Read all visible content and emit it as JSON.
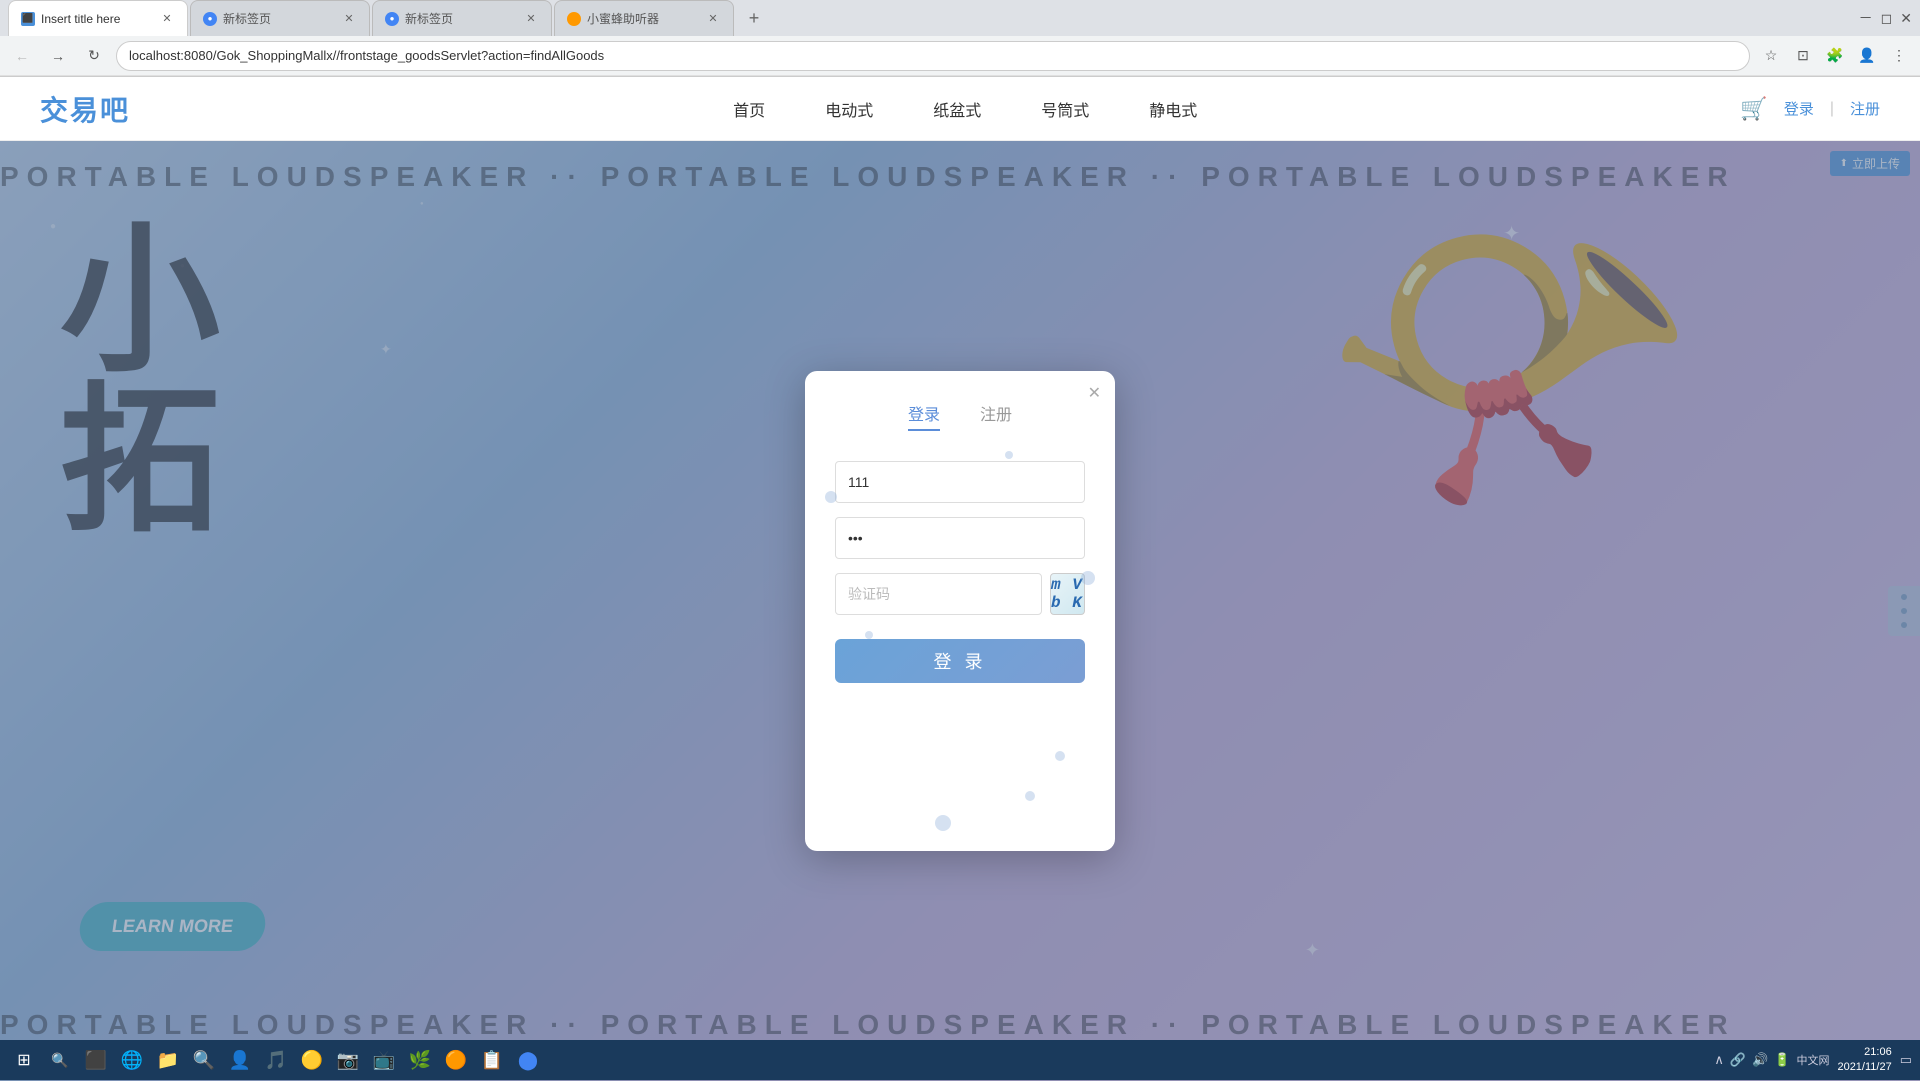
{
  "browser": {
    "tabs": [
      {
        "id": "tab1",
        "title": "Insert title here",
        "favicon": "page",
        "active": true
      },
      {
        "id": "tab2",
        "title": "新标签页",
        "favicon": "chrome",
        "active": false
      },
      {
        "id": "tab3",
        "title": "新标签页",
        "favicon": "chrome",
        "active": false
      },
      {
        "id": "tab4",
        "title": "小蜜蜂助听器",
        "favicon": "bee",
        "active": false
      }
    ],
    "url": "localhost:8080/Gok_ShoppingMallx//frontstage_goodsServlet?action=findAllGoods",
    "new_tab_label": "+"
  },
  "site": {
    "logo": "交易吧",
    "nav": [
      "首页",
      "电动式",
      "纸盆式",
      "号筒式",
      "静电式"
    ],
    "login": "登录",
    "register": "注册",
    "divider": "|"
  },
  "banner": {
    "marquee_top": "PORTABLE LOUDSPEAKER  ··  PORTABLE LOUDSPEAKER  ··  PORTABLE LOUDSPEAKER",
    "marquee_bottom": "PORTABLE LOUDSPEAKER  ··  PORTABLE LOUDSPEAKER  ··  PORTABLE LOUDSPEAKER",
    "big_text_line1": "小",
    "big_text_line2": "拓",
    "learn_more": "LEARN MORE",
    "promo_badge": "立即上传"
  },
  "modal": {
    "close_label": "✕",
    "tab_login": "登录",
    "tab_register": "注册",
    "username_value": "111",
    "username_placeholder": "",
    "password_value": "•••",
    "password_placeholder": "",
    "captcha_placeholder": "验证码",
    "captcha_display": "m V b K",
    "login_button": "登 录"
  },
  "taskbar": {
    "start_icon": "⊞",
    "search_icon": "🔍",
    "time": "21:06",
    "date": "2021/11/27",
    "system_text": "中文网"
  }
}
